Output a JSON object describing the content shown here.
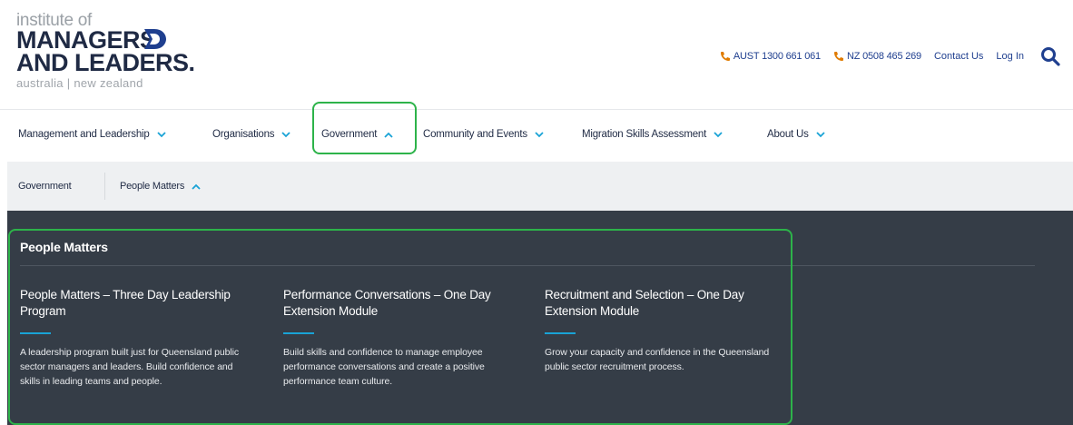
{
  "logo": {
    "line1": "institute of",
    "line2": "MANAGERS",
    "line3": "AND LEADERS.",
    "line4": "australia | new zealand"
  },
  "utility": {
    "phone_au": "AUST 1300 661 061",
    "phone_nz": "NZ 0508 465 269",
    "contact": "Contact Us",
    "login": "Log In"
  },
  "nav": {
    "items": [
      {
        "label": "Management and Leadership"
      },
      {
        "label": "Organisations"
      },
      {
        "label": "Government"
      },
      {
        "label": "Community and Events"
      },
      {
        "label": "Migration Skills Assessment"
      },
      {
        "label": "About Us"
      }
    ]
  },
  "subnav": {
    "items": [
      {
        "label": "Government"
      },
      {
        "label": "People Matters"
      }
    ]
  },
  "panel": {
    "title": "People Matters",
    "columns": [
      {
        "title": "People Matters – Three Day Leadership Program",
        "description": "A leadership program built just for Queensland public sector managers and leaders. Build confidence and skills in leading teams and people."
      },
      {
        "title": "Performance Conversations – One Day Extension Module",
        "description": "Build skills and confidence to manage employee performance conversations and create a positive performance team culture."
      },
      {
        "title": "Recruitment and Selection – One Day Extension Module",
        "description": "Grow your capacity and confidence in the Queensland public sector recruitment process."
      }
    ]
  },
  "colors": {
    "brand_navy": "#1f2a44",
    "link_blue": "#1f3f8f",
    "phone_orange": "#e07b00",
    "panel_bg": "#353d47",
    "accent_cyan": "#19a3d6",
    "highlight_green": "#2db34a"
  },
  "icons": [
    "logo-mark-icon",
    "phone-icon",
    "search-icon",
    "chevron-down-icon",
    "chevron-up-icon"
  ]
}
